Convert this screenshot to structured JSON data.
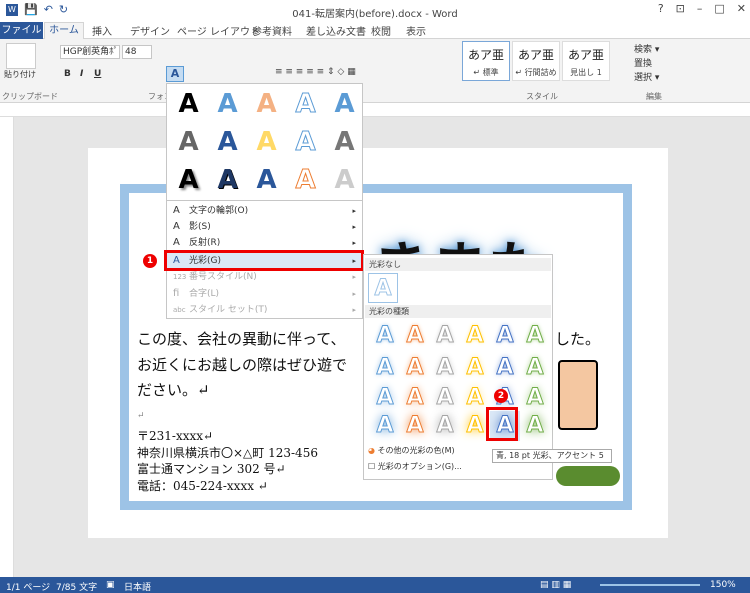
{
  "window": {
    "title": "041-転居案内(before).docx - Word",
    "controls": [
      "?",
      "⊡",
      "–",
      "□",
      "✕"
    ]
  },
  "qat": {
    "save": "💾",
    "undo": "↶",
    "redo": "↻"
  },
  "tabs": [
    "ファイル",
    "ホーム",
    "挿入",
    "デザイン",
    "ページ レイアウト",
    "参考資料",
    "差し込み文書",
    "校閲",
    "表示"
  ],
  "ribbon": {
    "paste_label": "貼り付け",
    "font_name": "HGP創英角ﾎﾟ",
    "font_size": "48",
    "clipboard_label": "クリップボード",
    "font_group_label": "フォン",
    "styles_label": "スタイル",
    "edit_label": "編集",
    "styles": [
      {
        "big": "あア亜",
        "small": "↵ 標準"
      },
      {
        "big": "あア亜",
        "small": "↵ 行間詰め"
      },
      {
        "big": "あア亜",
        "small": "見出し 1"
      }
    ],
    "edit_items": [
      "検索 ▾",
      "置換",
      "選択 ▾"
    ]
  },
  "document": {
    "line1": "この度、会社の異動に伴って、",
    "line1_tail": "した。",
    "line2": "お近くにお越しの際はぜひ遊で",
    "line3": "ださい。↵",
    "mark": "↵",
    "addr1": "〒231-xxxx↵",
    "addr2": "神奈川県横浜市〇×△町 123-456",
    "addr3": "富士通マンション 302 号↵",
    "addr4": "電話：045-224-xxxx ↵",
    "heading_partial": "きまた"
  },
  "effects_menu": {
    "items": [
      {
        "icon": "A",
        "label": "文字の輪郭(O)",
        "arrow": "▸"
      },
      {
        "icon": "A",
        "label": "影(S)",
        "arrow": "▸"
      },
      {
        "icon": "A",
        "label": "反射(R)",
        "arrow": "▸"
      },
      {
        "icon": "A",
        "label": "光彩(G)",
        "arrow": "▸"
      },
      {
        "icon": "123",
        "label": "番号スタイル(N)",
        "arrow": "▸"
      },
      {
        "icon": "fi",
        "label": "合字(L)",
        "arrow": "▸"
      },
      {
        "icon": "abc",
        "label": "スタイル セット(T)",
        "arrow": "▸"
      }
    ]
  },
  "glow_submenu": {
    "none_header": "光彩なし",
    "types_header": "光彩の種類",
    "more_colors": "その他の光彩の色(M)",
    "options": "光彩のオプション(G)...",
    "tooltip": "青, 18 pt 光彩、アクセント 5"
  },
  "glyph": "A",
  "badges": [
    "1",
    "2"
  ],
  "statusbar": {
    "page": "1/1 ページ",
    "words": "7/85 文字",
    "lang": "日本語",
    "zoom": "150%"
  },
  "colors": {
    "accent": "#2b579a",
    "highlight": "#e00000",
    "glow_blue": "#5b9bd5"
  }
}
